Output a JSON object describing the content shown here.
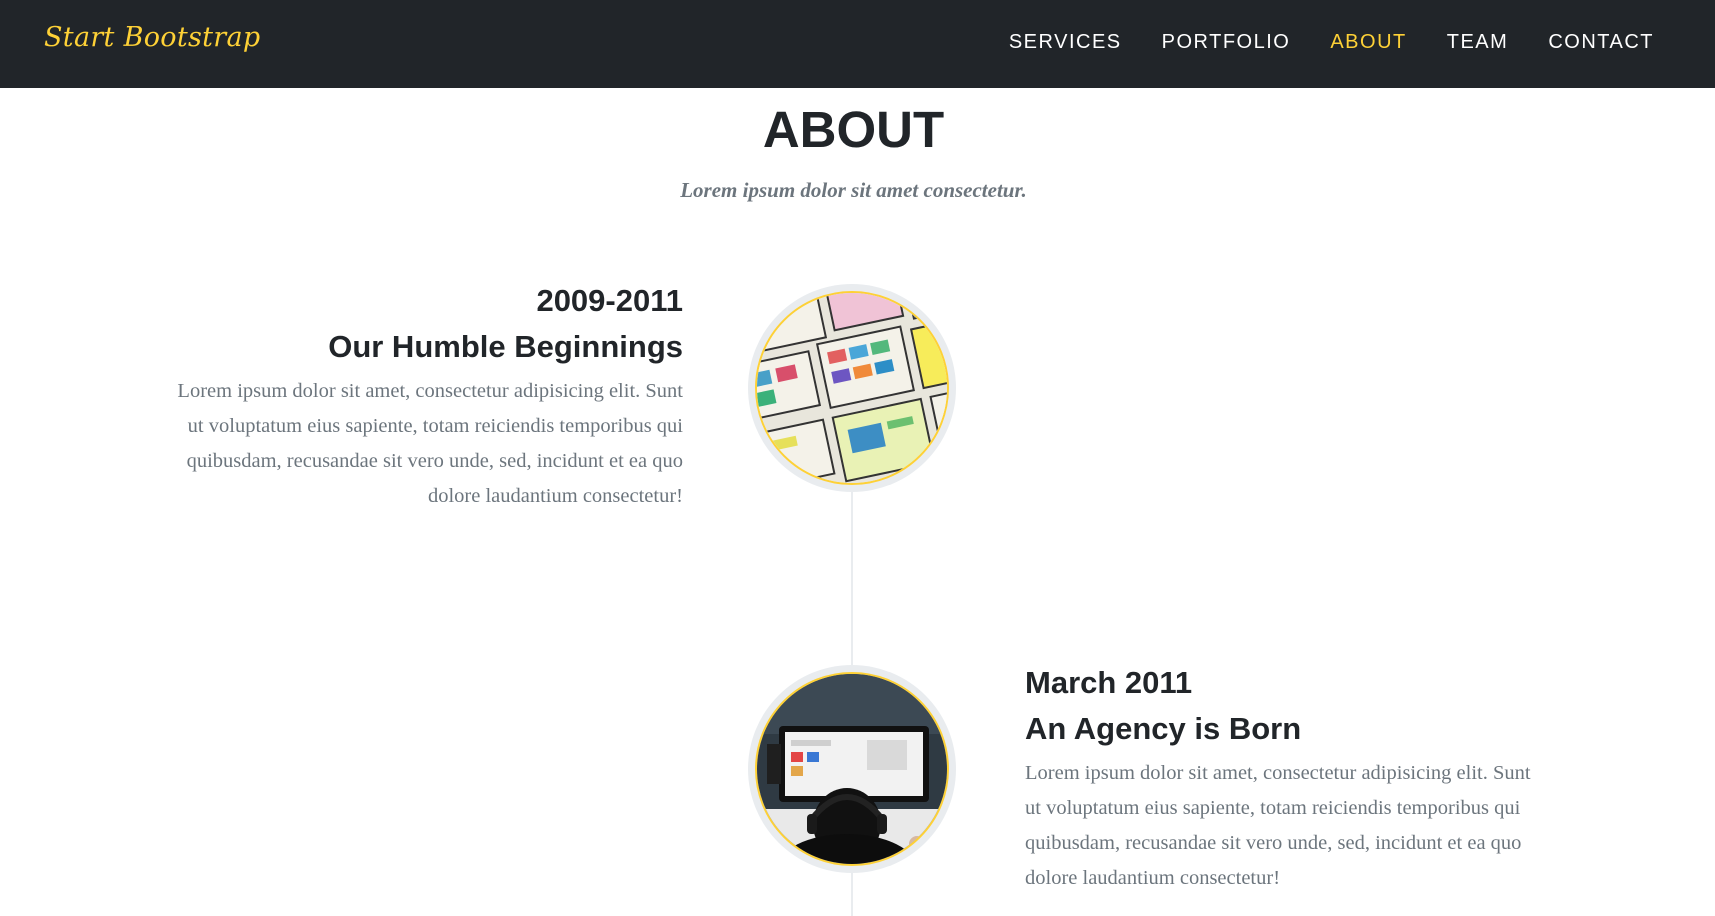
{
  "navbar": {
    "brand": "Start Bootstrap",
    "links": [
      {
        "label": "Services",
        "active": false
      },
      {
        "label": "Portfolio",
        "active": false
      },
      {
        "label": "About",
        "active": true
      },
      {
        "label": "Team",
        "active": false
      },
      {
        "label": "Contact",
        "active": false
      }
    ]
  },
  "about": {
    "heading": "ABOUT",
    "subheading": "Lorem ipsum dolor sit amet consectetur."
  },
  "timeline": [
    {
      "date": "2009-2011",
      "title": "Our Humble Beginnings",
      "body": "Lorem ipsum dolor sit amet, consectetur adipisicing elit. Sunt ut voluptatum eius sapiente, totam reiciendis temporibus qui quibusdam, recusandae sit vero unde, sed, incidunt et ea quo dolore laudantium consectetur!",
      "image": "wireframe-sketches-photo"
    },
    {
      "date": "March 2011",
      "title": "An Agency is Born",
      "body": "Lorem ipsum dolor sit amet, consectetur adipisicing elit. Sunt ut voluptatum eius sapiente, totam reiciendis temporibus qui quibusdam, recusandae sit vero unde, sed, incidunt et ea quo dolore laudantium consectetur!",
      "image": "person-at-computer-photo"
    }
  ],
  "colors": {
    "navbar_bg": "#212529",
    "accent": "#fed136",
    "muted_text": "#6c757d",
    "timeline_line": "#e9ecef"
  }
}
